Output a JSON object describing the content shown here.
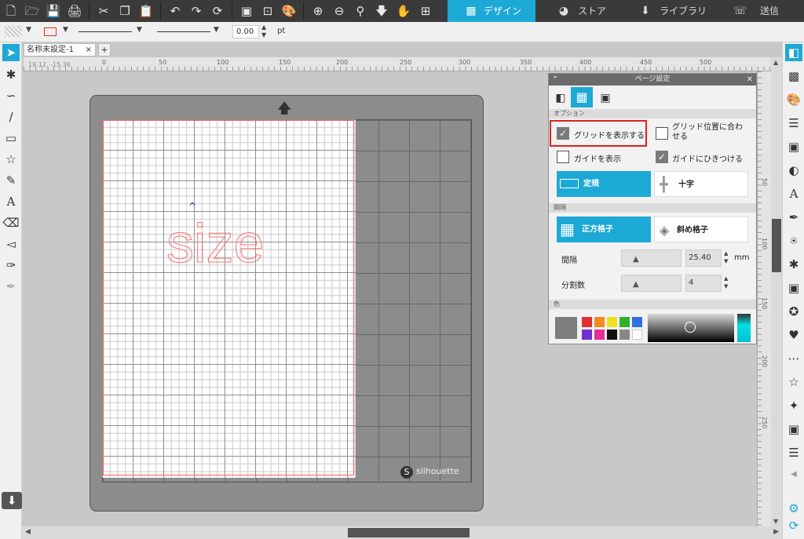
{
  "toolbar": {
    "icons": [
      "new-icon",
      "open-icon",
      "save-icon",
      "print-icon",
      "cut-icon",
      "copy-icon",
      "paste-icon",
      "undo-icon",
      "redo-icon",
      "refresh-icon",
      "group-icon",
      "ungroup-icon",
      "palette-icon",
      "zoom-in-icon",
      "zoom-out-icon",
      "zoom-fit-icon",
      "move-down-icon",
      "pan-hand-icon",
      "add-icon"
    ]
  },
  "nav": {
    "design": "デザイン",
    "store": "ストア",
    "library": "ライブラリ",
    "send": "送信"
  },
  "subbar": {
    "stroke_value": "0.00",
    "unit": "pt"
  },
  "document": {
    "tab_label": "名称未設定-1",
    "add_tab": "+",
    "close": "×",
    "coords": "19.12, -15.36"
  },
  "ruler": {
    "h_ticks": [
      "0",
      "50",
      "100",
      "150",
      "200",
      "250",
      "300",
      "350",
      "400",
      "450",
      "500"
    ],
    "v_ticks": [
      "50",
      "100",
      "150",
      "200",
      "250"
    ]
  },
  "canvas": {
    "text": "size",
    "brand": "silhouette"
  },
  "panel": {
    "title": "ページ設定",
    "section_options": "オプション",
    "show_grid": "グリッドを表示する",
    "show_grid_checked": true,
    "snap_grid": "グリッド位置に合わせる",
    "snap_grid_checked": false,
    "show_guides": "ガイドを表示",
    "show_guides_checked": false,
    "snap_guides": "ガイドにひきつける",
    "snap_guides_checked": true,
    "ruler_btn": "定規",
    "crosshair_btn": "十字",
    "section_spacing": "間隔",
    "square_grid": "正方格子",
    "diagonal_grid": "斜め格子",
    "spacing_label": "間隔",
    "spacing_value": "25.40",
    "spacing_unit": "mm",
    "divisions_label": "分割数",
    "divisions_value": "4",
    "section_color": "色",
    "swatches": [
      "#e03030",
      "#f08a20",
      "#f0e020",
      "#30b030",
      "#3070e0",
      "#7030d0",
      "#e03090",
      "#111111",
      "#888888",
      "#ffffff"
    ]
  }
}
